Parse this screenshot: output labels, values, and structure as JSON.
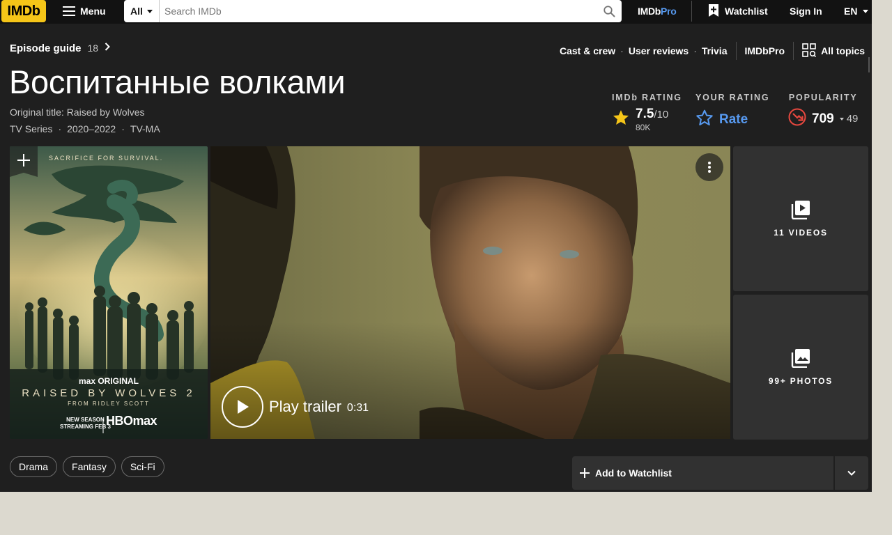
{
  "nav": {
    "logo": "IMDb",
    "menu_label": "Menu",
    "search_category": "All",
    "search_placeholder": "Search IMDb",
    "imdbpro_imdb": "IMDb",
    "imdbpro_pro": "Pro",
    "watchlist_label": "Watchlist",
    "signin_label": "Sign In",
    "language": "EN"
  },
  "episode_guide": {
    "label": "Episode guide",
    "count": "18"
  },
  "top_links": {
    "cast_crew": "Cast & crew",
    "user_reviews": "User reviews",
    "trivia": "Trivia",
    "imdbpro": "IMDbPro",
    "all_topics": "All topics"
  },
  "title": {
    "main": "Воспитанные волками",
    "original": "Original title: Raised by Wolves",
    "type": "TV Series",
    "years": "2020–2022",
    "certificate": "TV-MA"
  },
  "ratings": {
    "imdb_heading": "IMDb RATING",
    "score": "7.5",
    "score_of": "/10",
    "votes": "80K",
    "your_heading": "YOUR RATING",
    "rate_label": "Rate",
    "pop_heading": "POPULARITY",
    "popularity": "709",
    "popularity_delta": "49"
  },
  "poster": {
    "tagline": "SACRIFICE FOR SURVIVAL.",
    "max_original": "max ORIGINAL",
    "series_title": "RAISED BY WOLVES 2",
    "from": "FROM RIDLEY SCOTT",
    "new_season": "NEW SEASON",
    "streaming": "STREAMING FEB 3",
    "network": "HBOmax"
  },
  "video": {
    "play_label": "Play trailer",
    "duration": "0:31"
  },
  "media_tiles": {
    "videos": "11 VIDEOS",
    "photos": "99+ PHOTOS"
  },
  "genres": [
    "Drama",
    "Fantasy",
    "Sci-Fi"
  ],
  "watchlist_button": "Add to Watchlist",
  "colors": {
    "imdb_yellow": "#f5c518",
    "link_blue": "#5799ef",
    "popularity_red": "#e8483f",
    "panel_bg": "#1f1f1f",
    "nav_bg": "#121212"
  }
}
